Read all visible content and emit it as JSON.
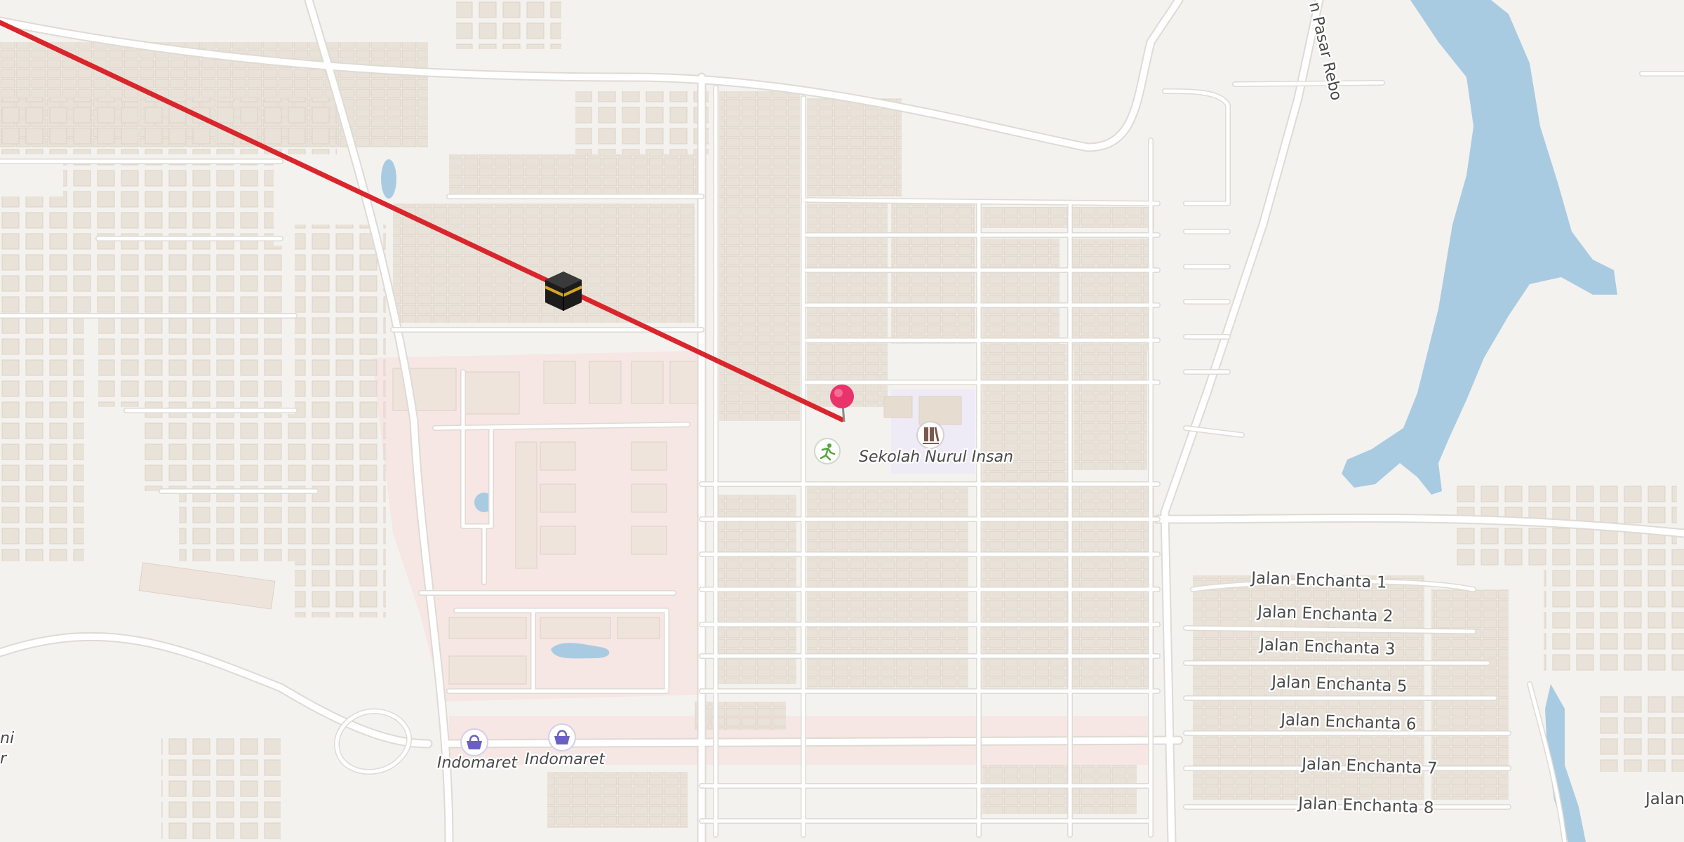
{
  "map": {
    "colors": {
      "land": "#f4f2ef",
      "block": "#efebe6",
      "building": "#e8e1d7",
      "building_edge": "#dcd2c5",
      "road": "#ffffff",
      "road_edge": "#dedad4",
      "water": "#a9cbe2",
      "campus": "#f5e4e2",
      "school_area": "#eeeaf6",
      "qibla_line": "#d9262c",
      "pin": "#e8336b",
      "shop_icon": "#6b5fc6",
      "school_icon": "#7a5a4a",
      "sport_icon": "#57a33a"
    },
    "streets": [
      {
        "name": "Jalan Enchanta 1"
      },
      {
        "name": "Jalan Enchanta 2"
      },
      {
        "name": "Jalan Enchanta 3"
      },
      {
        "name": "Jalan Enchanta 5"
      },
      {
        "name": "Jalan Enchanta 6"
      },
      {
        "name": "Jalan Enchanta 7"
      },
      {
        "name": "Jalan Enchanta 8"
      },
      {
        "name": "Jalan"
      }
    ],
    "road_label": "n Pasar Rebo",
    "pois": [
      {
        "name": "Sekolah Nurul Insan",
        "icon": "school-icon"
      },
      {
        "name": "Indomaret",
        "icon": "shopping-basket-icon"
      },
      {
        "name": "Indomaret",
        "icon": "shopping-basket-icon"
      }
    ],
    "edge_fragment": [
      "ni",
      "r"
    ],
    "markers": {
      "kaaba": {
        "icon": "kaaba-icon"
      },
      "pin": {
        "icon": "location-pin-icon"
      },
      "sport": {
        "icon": "sports-icon"
      }
    }
  }
}
